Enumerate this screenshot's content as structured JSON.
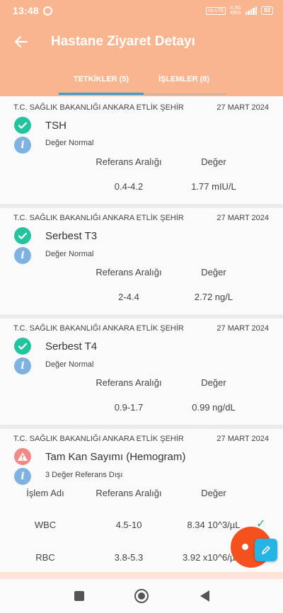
{
  "status_bar": {
    "time": "13:48",
    "network_box": "Vo LTE",
    "network_speed": "4,5G",
    "network_unit": "KB/s",
    "battery": "83"
  },
  "app_bar": {
    "title": "Hastane Ziyaret Detayı"
  },
  "tabs": [
    {
      "label": "TETKİKLER (5)",
      "selected": true
    },
    {
      "label": "İŞLEMLER (8)",
      "selected": false
    }
  ],
  "columns": {
    "name": "İşlem Adı",
    "range": "Referans Aralığı",
    "value": "Değer"
  },
  "results": [
    {
      "hospital": "T.C. SAĞLIK BAKANLIĞI ANKARA ETLİK ŞEHİR",
      "date": "27 MART 2024",
      "test": "TSH",
      "status": "ok",
      "status_text": "Değer Normal",
      "rows": [
        {
          "range": "0.4-4.2",
          "value": "1.77 mIU/L"
        }
      ]
    },
    {
      "hospital": "T.C. SAĞLIK BAKANLIĞI ANKARA ETLİK ŞEHİR",
      "date": "27 MART 2024",
      "test": "Serbest T3",
      "status": "ok",
      "status_text": "Değer Normal",
      "rows": [
        {
          "range": "2-4.4",
          "value": "2.72 ng/L"
        }
      ]
    },
    {
      "hospital": "T.C. SAĞLIK BAKANLIĞI ANKARA ETLİK ŞEHİR",
      "date": "27 MART 2024",
      "test": "Serbest T4",
      "status": "ok",
      "status_text": "Değer Normal",
      "rows": [
        {
          "range": "0.9-1.7",
          "value": "0.99 ng/dL"
        }
      ]
    },
    {
      "hospital": "T.C. SAĞLIK BAKANLIĞI ANKARA ETLİK ŞEHİR",
      "date": "27 MART 2024",
      "test": "Tam Kan Sayımı (Hemogram)",
      "status": "warn",
      "status_text": "3 Değer Referans Dışı",
      "rows": [
        {
          "name": "WBC",
          "range": "4.5-10",
          "value": "8.34 10^3/µL"
        },
        {
          "name": "RBC",
          "range": "3.8-5.3",
          "value": "3.92 x10^6/µL"
        }
      ]
    }
  ],
  "colors": {
    "header": "#f8b58f",
    "ok": "#23c3a0",
    "warn": "#f28a86",
    "info": "#7fb2e1",
    "fab": "#f4511e",
    "fab_secondary": "#26b4e4"
  },
  "icons": {
    "back": "arrow-left-icon",
    "ok": "check-circle-icon",
    "warn": "warning-triangle-icon",
    "info": "info-icon",
    "edit": "pen-icon"
  }
}
